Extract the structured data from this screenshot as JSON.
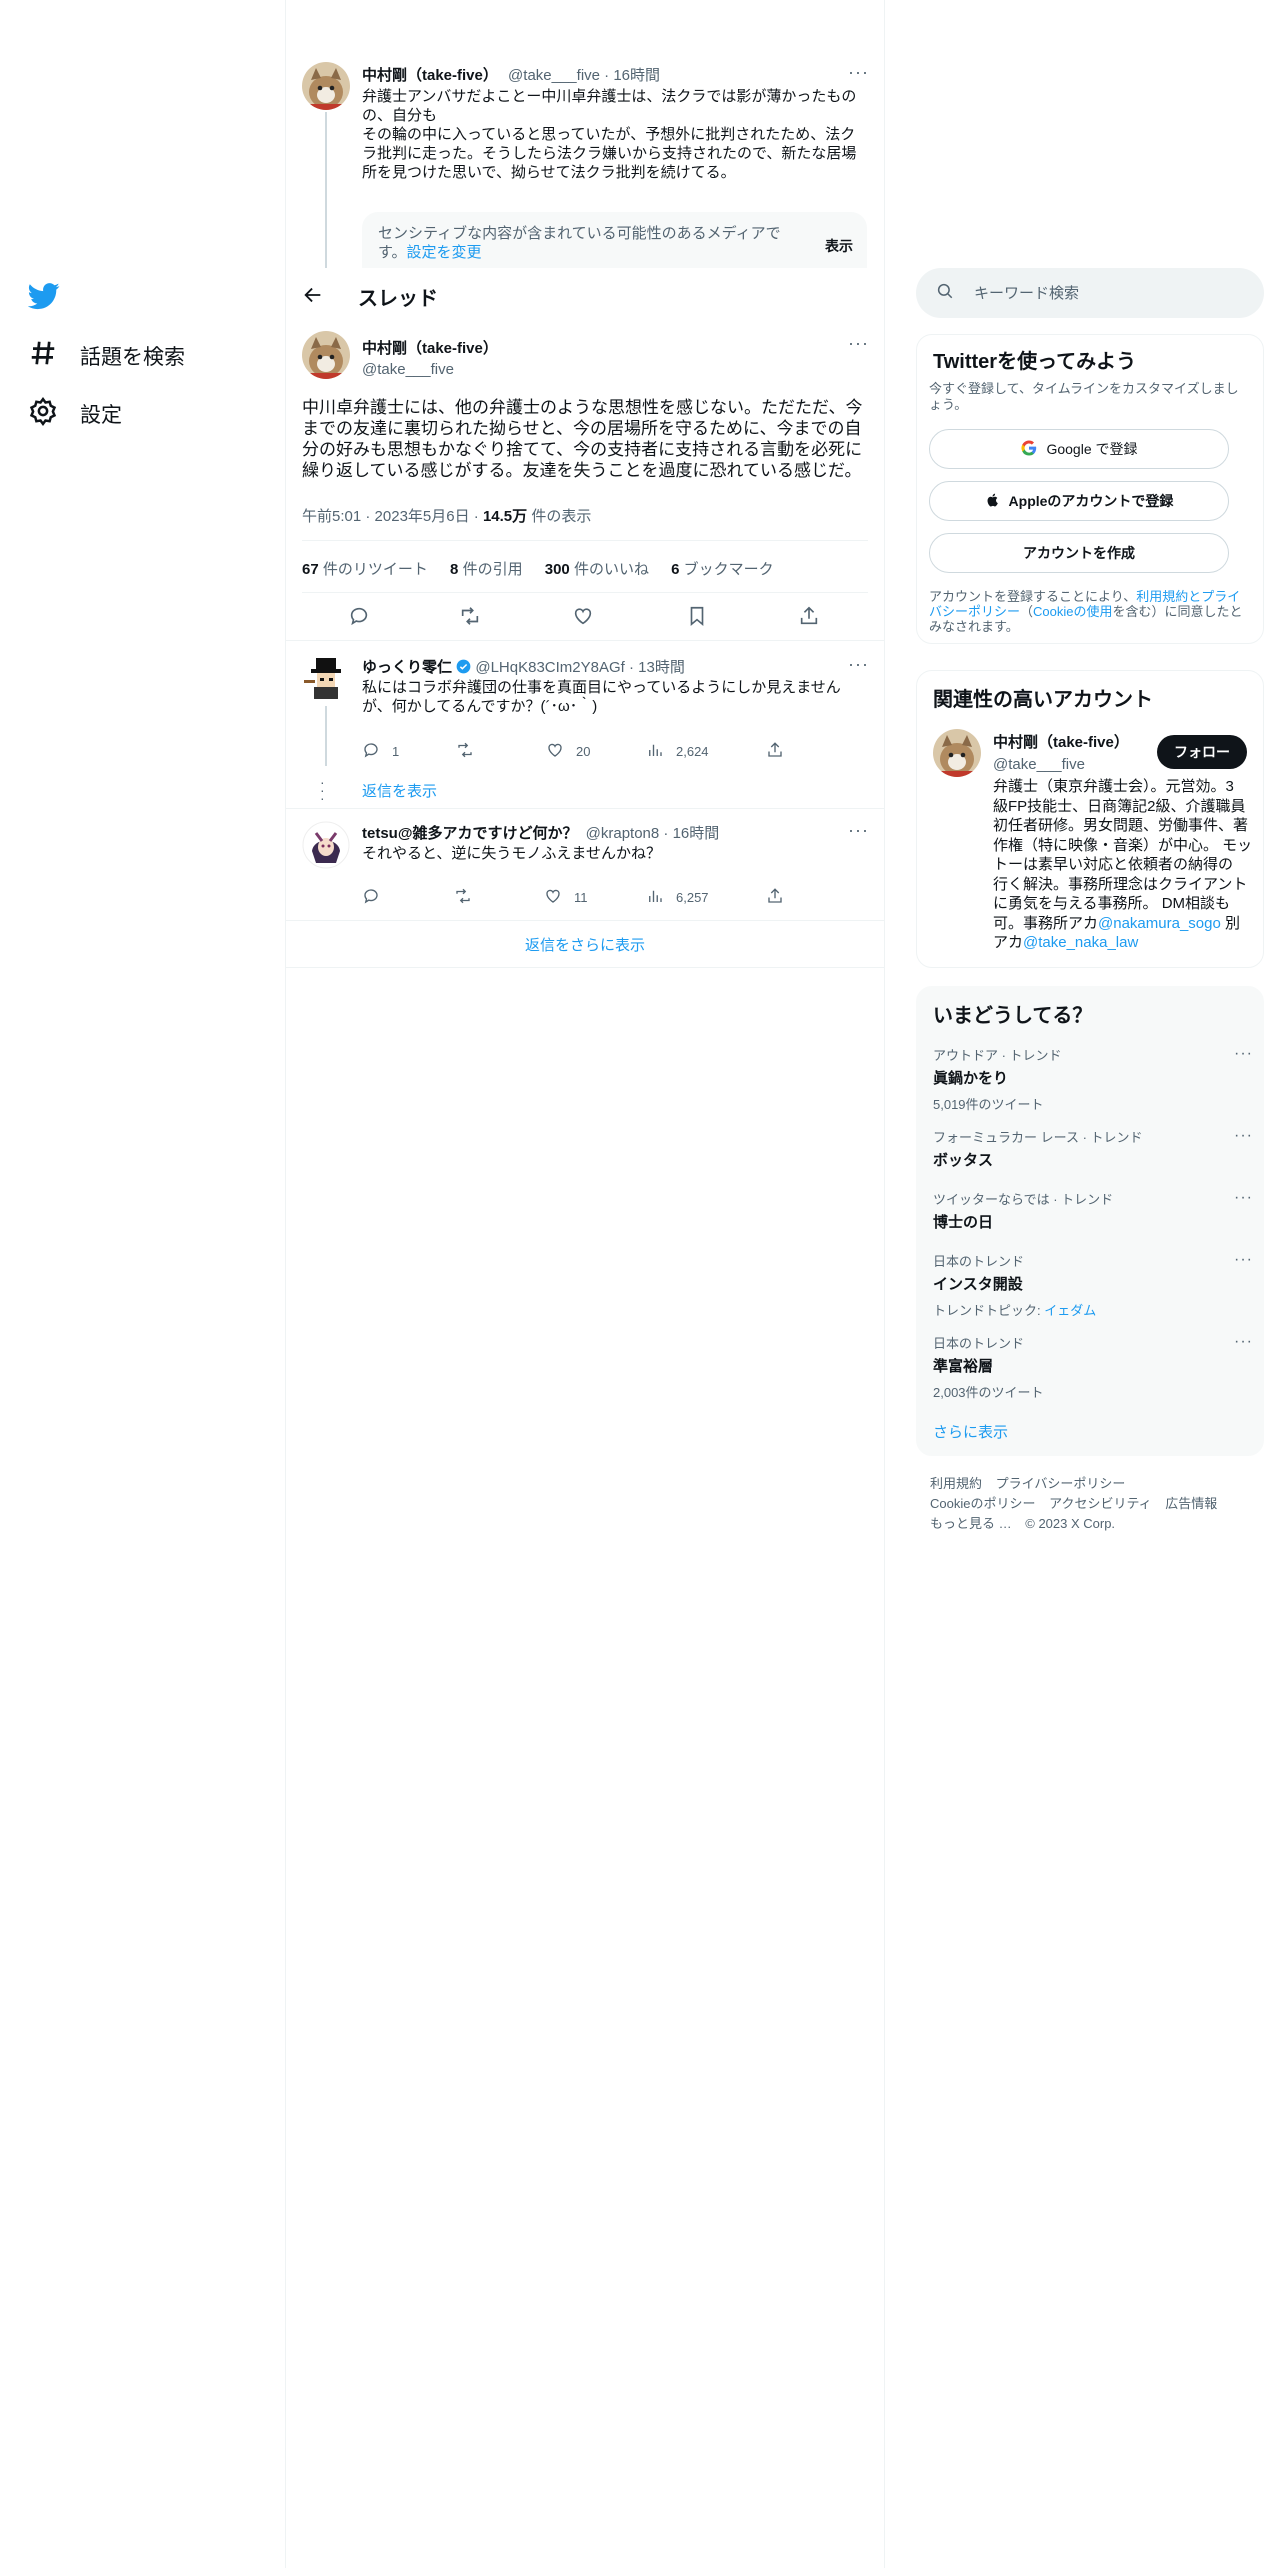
{
  "nav": {
    "items": [
      {
        "label": "話題を検索",
        "icon": "hashtag-icon"
      },
      {
        "label": "設定",
        "icon": "gear-icon"
      }
    ]
  },
  "parent_tweet": {
    "name": "中村剛（take-five）",
    "handle": "@take___five",
    "time": "16時間",
    "text_lines": [
      "弁護士アンバサだよことー中川卓弁護士は、法クラでは影が薄かったもの",
      "の、自分も",
      "その輪の中に入っていると思っていたが、予想外に批判されたため、法ク",
      "ラ批判に走った。そうしたら法クラ嫌いから支持されたので、新たな居場",
      "所を見つけた思いで、拗らせて法クラ批判を続けてる。"
    ],
    "sensitive_notice": "センシティブな内容が含まれている可能性のあるメディアで",
    "sensitive_notice2": "す。",
    "sensitive_link": "設定を変更",
    "show_label": "表示"
  },
  "thread_header": {
    "title": "スレッド"
  },
  "main_tweet": {
    "name": "中村剛（take-five）",
    "handle": "@take___five",
    "text_lines": [
      "中川卓弁護士には、他の弁護士のような思想性を感じない。ただただ、今",
      "までの友達に裏切られた拗らせと、今の居場所を守るために、今までの自",
      "分の好みも思想もかなぐり捨てて、今の支持者に支持される言動を必死に",
      "繰り返している感じがする。友達を失うことを過度に恐れている感じだ。"
    ],
    "time": "午前5:01",
    "date": "2023年5月6日",
    "views": "14.5万",
    "views_label": "件の表示",
    "stats": [
      {
        "num": "67",
        "label": "件のリツイート"
      },
      {
        "num": "8",
        "label": "件の引用"
      },
      {
        "num": "300",
        "label": "件のいいね"
      },
      {
        "num": "6",
        "label": "ブックマーク"
      }
    ]
  },
  "replies": [
    {
      "name": "ゆっくり零仁",
      "handle": "@LHqK83CIm2Y8AGf",
      "time": "13時間",
      "text_lines": [
        "私にはコラボ弁護団の仕事を真面目にやっているようにしか見えません",
        "が、何かしてるんですか？(´･ω･｀)"
      ],
      "replies": "1",
      "likes": "20",
      "views": "2,624",
      "show_replies": "返信を表示"
    },
    {
      "name": "tetsu@雑多アカですけど何か？",
      "handle": "@krapton8",
      "time": "16時間",
      "text_lines": [
        "それやると、逆に失うモノふえませんかね？"
      ],
      "replies": "",
      "likes": "11",
      "views": "6,257"
    }
  ],
  "more_replies": "返信をさらに表示",
  "sidebar": {
    "search_placeholder": "キーワード検索",
    "signup": {
      "title": "Twitterを使ってみよう",
      "subtitle_line1": "今すぐ登録して、タイムラインをカスタマイズしまし",
      "subtitle_line2": "ょう。",
      "google": "Google で登録",
      "apple": "Appleのアカウントで登録",
      "create": "アカウントを作成",
      "terms_pre": "アカウントを登録することにより、",
      "terms_link1": "利用規約とプライ",
      "terms_link1b": "バシーポリシー",
      "terms_mid": "（",
      "terms_link2": "Cookieの使用",
      "terms_post": "を含む）に同意したと",
      "terms_end": "みなされます。"
    },
    "related": {
      "title": "関連性の高いアカウント",
      "name": "中村剛（take-five）",
      "handle": "@take___five",
      "follow": "フォロー",
      "bio_lines": [
        "弁護士（東京弁護士会）。元営効。3",
        "級FP技能士、日商簿記2級、介護職員",
        "初任者研修。男女問題、労働事件、著",
        "作権（特に映像・音楽）が中心。 モッ",
        "トーは素早い対応と依頼者の納得の",
        "行く解決。事務所理念はクライアント",
        "に勇気を与える事務所。 DM相談も"
      ],
      "bio_line8_pre": "可。事務所アカ",
      "bio_link1": "@nakamura_sogo",
      "bio_line8_post": " 別",
      "bio_line9_pre": "アカ",
      "bio_link2": "@take_naka_law"
    },
    "trends": {
      "title": "いまどうしてる？",
      "items": [
        {
          "category": "アウトドア · トレンド",
          "name": "眞鍋かをり",
          "count": "5,019件のツイート"
        },
        {
          "category": "フォーミュラカー レース · トレンド",
          "name": "ボッタス",
          "count": ""
        },
        {
          "category": "ツイッターならでは · トレンド",
          "name": "博士の日",
          "count": ""
        },
        {
          "category": "日本のトレンド",
          "name": "インスタ開設",
          "count": "トレンドトピック: ",
          "count_link": "イェダム"
        },
        {
          "category": "日本のトレンド",
          "name": "準富裕層",
          "count": "2,003件のツイート"
        }
      ],
      "more": "さらに表示"
    },
    "footer": {
      "line1": [
        "利用規約",
        "プライバシーポリシー"
      ],
      "line2": [
        "Cookieのポリシー",
        "アクセシビリティ",
        "広告情報"
      ],
      "line3": [
        "もっと見る …",
        "© 2023 X Corp."
      ]
    }
  },
  "colors": {
    "accent": "#1d9bf0",
    "text": "#0f1419",
    "muted": "#536471",
    "border": "#eff3f4"
  }
}
